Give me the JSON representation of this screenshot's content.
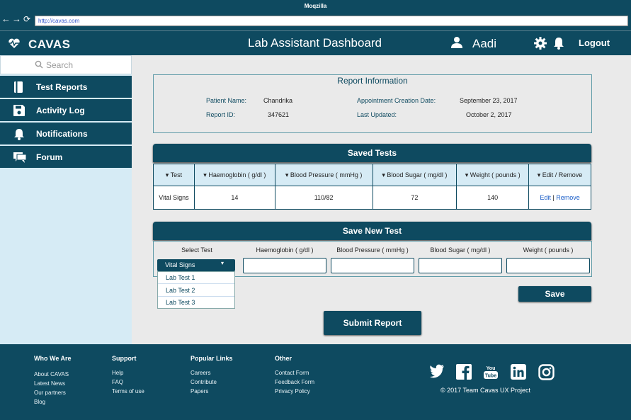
{
  "browser": {
    "title": "Moqzilla",
    "url": "http://cavas.com"
  },
  "header": {
    "brand": "CAVAS",
    "title": "Lab Assistant Dashboard",
    "user": "Aadi",
    "logout": "Logout"
  },
  "sidebar": {
    "search_placeholder": "Search",
    "items": [
      {
        "label": "Test Reports",
        "icon": "report-icon"
      },
      {
        "label": "Activity Log",
        "icon": "save-icon"
      },
      {
        "label": "Notifications",
        "icon": "bell-icon"
      },
      {
        "label": "Forum",
        "icon": "forum-icon"
      }
    ]
  },
  "report": {
    "title": "Report Information",
    "patient_label": "Patient Name:",
    "patient": "Chandrika",
    "id_label": "Report ID:",
    "id": "347621",
    "created_label": "Appointment Creation Date:",
    "created": "September 23, 2017",
    "updated_label": "Last Updated:",
    "updated": "October 2, 2017"
  },
  "saved_tests": {
    "title": "Saved Tests",
    "columns": [
      "▾ Test",
      "▾ Haemoglobin ( g/dl )",
      "▾ Blood Pressure ( mmHg )",
      "▾ Blood Sugar ( mg/dl )",
      "▾ Weight ( pounds )",
      "▾ Edit / Remove"
    ],
    "rows": [
      {
        "test": "Vital Signs",
        "haemoglobin": "14",
        "bp": "110/82",
        "sugar": "72",
        "weight": "140",
        "edit": "Edit",
        "sep": "|",
        "remove": "Remove"
      }
    ]
  },
  "new_test": {
    "title": "Save New Test",
    "labels": [
      "Select Test",
      "Haemoglobin ( g/dl )",
      "Blood Pressure ( mmHg )",
      "Blood Sugar ( mg/dl )",
      "Weight ( pounds )"
    ],
    "selected": "Vital Signs",
    "options": [
      "Lab Test 1",
      "Lab Test 2",
      "Lab Test 3"
    ],
    "save": "Save",
    "submit": "Submit Report"
  },
  "footer": {
    "cols": [
      {
        "head": "Who We Are",
        "links": [
          "About CAVAS",
          "Latest News",
          "Our partners",
          "Blog"
        ]
      },
      {
        "head": "Support",
        "links": [
          "Help",
          "FAQ",
          "Terms of use"
        ]
      },
      {
        "head": "Popular Links",
        "links": [
          "Careers",
          "Contribute",
          "Papers"
        ]
      },
      {
        "head": "Other",
        "links": [
          "Contact Form",
          "Feedback Form",
          "Privacy Policy"
        ]
      }
    ],
    "social": [
      "twitter-icon",
      "facebook-icon",
      "youtube-icon",
      "linkedin-icon",
      "instagram-icon"
    ],
    "copyright": "2017 Team Cavas UX Project"
  },
  "colors": {
    "primary": "#0e4a60",
    "sidebar_bg": "#d6ebf5",
    "main_bg": "#eaeaea",
    "link": "#1a5ec8"
  }
}
